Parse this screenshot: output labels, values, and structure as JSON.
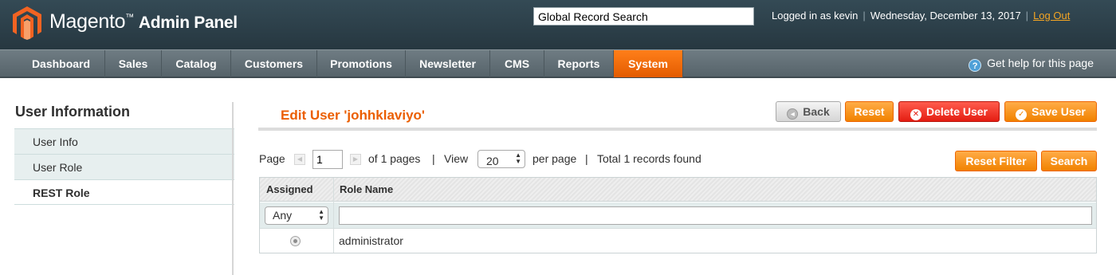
{
  "header": {
    "brand": "Magento",
    "brand_sub": "Admin Panel",
    "search_value": "Global Record Search",
    "logged_in": "Logged in as kevin",
    "date": "Wednesday, December 13, 2017",
    "logout": "Log Out"
  },
  "nav": {
    "items": [
      "Dashboard",
      "Sales",
      "Catalog",
      "Customers",
      "Promotions",
      "Newsletter",
      "CMS",
      "Reports",
      "System"
    ],
    "active": "System",
    "help": "Get help for this page"
  },
  "sidebar": {
    "title": "User Information",
    "items": [
      {
        "label": "User Info"
      },
      {
        "label": "User Role"
      },
      {
        "label": "REST Role"
      }
    ]
  },
  "content": {
    "title": "Edit User 'johhklaviyo'",
    "buttons": {
      "back": "Back",
      "reset": "Reset",
      "delete": "Delete User",
      "save": "Save User"
    }
  },
  "pager": {
    "page_label": "Page",
    "page_value": "1",
    "of_pages": "of 1 pages",
    "view_label": "View",
    "per_page_value": "20",
    "per_page_label": "per page",
    "total": "Total 1 records found",
    "reset_filter": "Reset Filter",
    "search": "Search"
  },
  "grid": {
    "columns": [
      "Assigned",
      "Role Name"
    ],
    "filter_assigned": "Any",
    "filter_role": "",
    "rows": [
      {
        "role_name": "administrator"
      }
    ]
  },
  "colors": {
    "accent": "#eb5e00",
    "header_bg": "#2b3e47",
    "nav_bg": "#56636a"
  }
}
